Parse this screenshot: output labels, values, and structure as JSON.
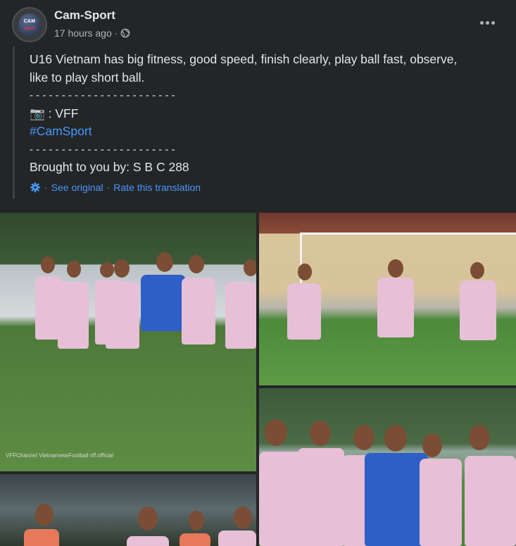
{
  "post": {
    "page_name": "Cam-Sport",
    "timestamp": "17 hours ago",
    "separator": "·",
    "avatar_label_top": "CAM",
    "avatar_label_bottom": "Sport",
    "lines": [
      "U16 Vietnam has big fitness, good speed, finish clearly, play ball fast, observe,",
      "like to play short ball.",
      "- - - - - - - - - - - - - - - - - - - - - - -",
      "📷 : VFF",
      "#CamSport",
      "- - - - - - - - - - - - - - - - - - - - - - -",
      "Brought to you by: S B C 288"
    ],
    "translation": {
      "see_original": "See original",
      "rate": "Rate this translation",
      "separator": "·"
    },
    "photo_watermark": "VFFChannel  VietnameseFootball  vff.official"
  },
  "colors": {
    "background": "#242526",
    "text": "#e4e6eb",
    "secondary_text": "#b0b3b8",
    "link": "#4599ff"
  },
  "icons": [
    "globe-icon",
    "more-options-icon",
    "gear-icon",
    "camera-icon"
  ]
}
